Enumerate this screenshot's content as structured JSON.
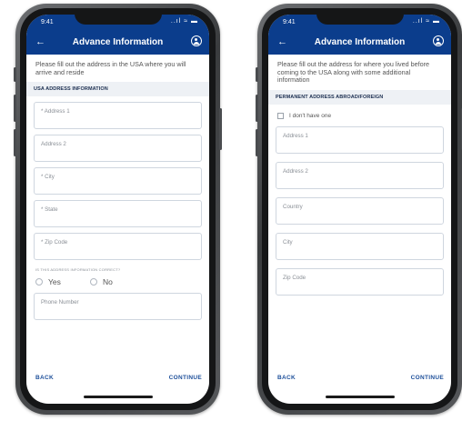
{
  "left_screen": {
    "status_time": "9:41",
    "status_indicators": "..ıl ≈ ▬",
    "title": "Advance Information",
    "back_glyph": "←",
    "intro": "Please fill out the address in the USA where you will arrive and reside",
    "section": "USA ADDRESS INFORMATION",
    "fields": [
      "* Address 1",
      "Address 2",
      "* City",
      "* State",
      "* Zip Code"
    ],
    "question": "IS THIS ADDRESS INFORMATION CORRECT?",
    "radio_yes": "Yes",
    "radio_no": "No",
    "phone_field": "Phone Number",
    "back": "BACK",
    "continue": "CONTINUE"
  },
  "right_screen": {
    "status_time": "9:41",
    "status_indicators": "..ıl ≈ ▬",
    "title": "Advance Information",
    "back_glyph": "←",
    "intro": "Please fill out the address for where you lived before coming to the USA along with some additional information",
    "section": "PERMANENT ADDRESS ABROAD/FOREIGN",
    "checkbox_label": "I don't have one",
    "fields": [
      "Address 1",
      "Address 2",
      "Country",
      "City",
      "Zip Code"
    ],
    "back": "BACK",
    "continue": "CONTINUE"
  },
  "colors": {
    "header": "#0b3d8c",
    "link": "#1d4f9a",
    "section_bg": "#eef1f5",
    "border": "#cfd6df"
  },
  "icons": {
    "back": "arrow-left-icon",
    "profile": "profile-icon",
    "radio": "radio-button-icon",
    "checkbox": "checkbox-icon"
  }
}
